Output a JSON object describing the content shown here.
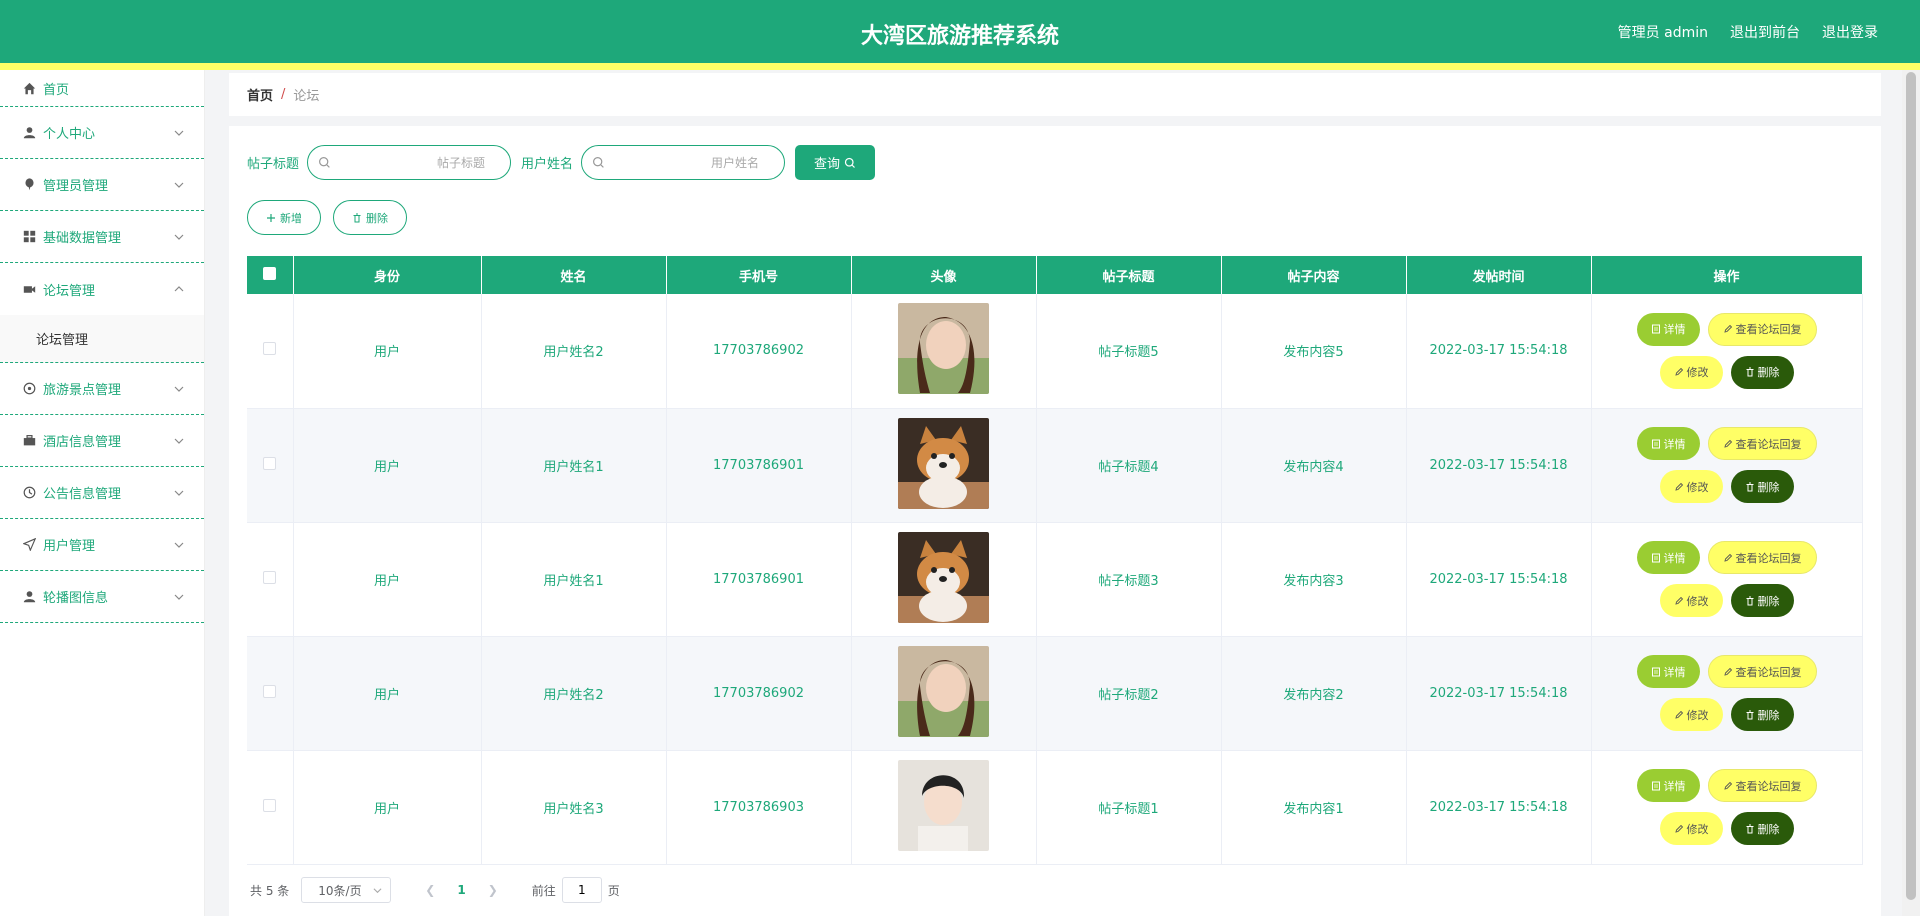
{
  "header": {
    "title": "大湾区旅游推荐系统",
    "admin_label": "管理员 admin",
    "to_front_label": "退出到前台",
    "logout_label": "退出登录"
  },
  "sidebar": {
    "items": [
      {
        "label": "首页",
        "icon": "home-icon"
      },
      {
        "label": "个人中心",
        "icon": "user-icon"
      },
      {
        "label": "管理员管理",
        "icon": "balloon-icon"
      },
      {
        "label": "基础数据管理",
        "icon": "grid-icon"
      },
      {
        "label": "论坛管理",
        "icon": "camera-icon"
      },
      {
        "label": "旅游景点管理",
        "icon": "compass-icon"
      },
      {
        "label": "酒店信息管理",
        "icon": "briefcase-icon"
      },
      {
        "label": "公告信息管理",
        "icon": "clock-icon"
      },
      {
        "label": "用户管理",
        "icon": "send-icon"
      },
      {
        "label": "轮播图信息",
        "icon": "user-icon"
      }
    ],
    "submenu_label": "论坛管理"
  },
  "breadcrumb": {
    "home": "首页",
    "separator": "/",
    "current": "论坛"
  },
  "search": {
    "title_label": "帖子标题",
    "title_placeholder": "帖子标题",
    "name_label": "用户姓名",
    "name_placeholder": "用户姓名",
    "query_label": "查询"
  },
  "actions": {
    "add_label": "新增",
    "delete_label": "删除"
  },
  "table": {
    "columns": [
      "身份",
      "姓名",
      "手机号",
      "头像",
      "帖子标题",
      "帖子内容",
      "发帖时间",
      "操作"
    ],
    "rows": [
      {
        "role": "用户",
        "name": "用户姓名2",
        "phone": "17703786902",
        "avatar": "woman-portrait",
        "title": "帖子标题5",
        "content": "发布内容5",
        "time": "2022-03-17 15:54:18"
      },
      {
        "role": "用户",
        "name": "用户姓名1",
        "phone": "17703786901",
        "avatar": "shiba-dog",
        "title": "帖子标题4",
        "content": "发布内容4",
        "time": "2022-03-17 15:54:18"
      },
      {
        "role": "用户",
        "name": "用户姓名1",
        "phone": "17703786901",
        "avatar": "shiba-dog",
        "title": "帖子标题3",
        "content": "发布内容3",
        "time": "2022-03-17 15:54:18"
      },
      {
        "role": "用户",
        "name": "用户姓名2",
        "phone": "17703786902",
        "avatar": "woman-portrait",
        "title": "帖子标题2",
        "content": "发布内容2",
        "time": "2022-03-17 15:54:18"
      },
      {
        "role": "用户",
        "name": "用户姓名3",
        "phone": "17703786903",
        "avatar": "woman-portrait-2",
        "title": "帖子标题1",
        "content": "发布内容1",
        "time": "2022-03-17 15:54:18"
      }
    ],
    "op_labels": {
      "detail": "详情",
      "reply": "查看论坛回复",
      "edit": "修改",
      "delete": "删除"
    }
  },
  "pagination": {
    "total": "共 5 条",
    "page_size": "10条/页",
    "current_page": "1",
    "goto_prefix": "前往",
    "goto_value": "1",
    "goto_suffix": "页"
  },
  "colors": {
    "primary": "#1ea87a",
    "accent_yellow": "#ffff66",
    "detail_green": "#9acd32",
    "delete_dark": "#2a5a0a"
  }
}
